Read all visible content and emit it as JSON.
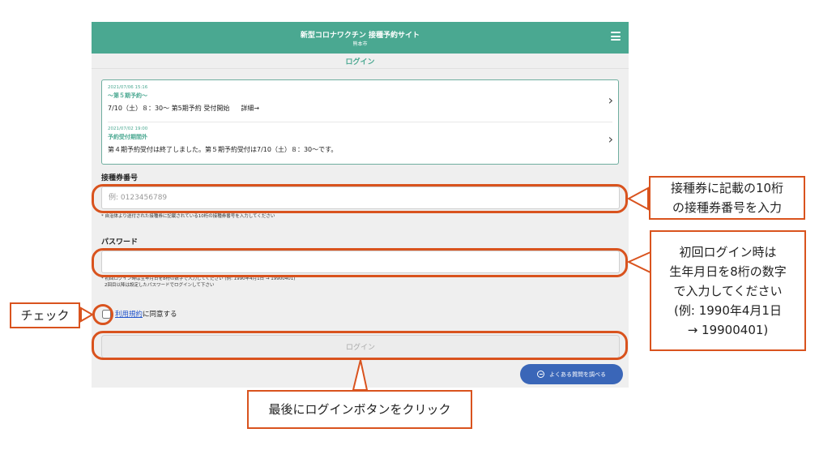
{
  "header": {
    "title": "新型コロナワクチン 接種予約サイト",
    "subtitle": "熊本市",
    "menu_icon": "hamburger-menu-icon"
  },
  "page_title": "ログイン",
  "news": [
    {
      "date": "2021/07/06 15:16",
      "title": "〜第５期予約〜",
      "body": "7/10（土）８：30〜 第5期予約 受付開始",
      "more": "詳細→"
    },
    {
      "date": "2021/07/02 19:00",
      "title": "予約受付期間外",
      "body": "第４期予約受付は終了しました。第５期予約受付は7/10（土）８：30〜です。"
    }
  ],
  "ticket": {
    "label": "接種券番号",
    "placeholder": "例: 0123456789",
    "hint": "* 自治体より送付された接種券に記載されている10桁の接種券番号を入力してください"
  },
  "password": {
    "label": "パスワード",
    "value": "",
    "hint1": "* 初回ログイン時は生年月日を8桁の数字で入力してください (例: 1990年4月1日 → 19900401)",
    "hint2": "2回目以降は設定したパスワードでログインして下さい"
  },
  "agree": {
    "link": "利用規約",
    "text": "に同意する"
  },
  "login_button": "ログイン",
  "faq_button": "よくある質問を調べる",
  "annotations": {
    "ticket": "接種券に記載の10桁\nの接種券番号を入力",
    "password": "初回ログイン時は\n生年月日を8桁の数字\nで入力してください\n(例: 1990年4月1日\n→ 19900401)",
    "check": "チェック",
    "login": "最後にログインボタンをクリック"
  },
  "colors": {
    "brand": "#4aa891",
    "annotation": "#d9531e",
    "faq": "#3a66b8"
  }
}
